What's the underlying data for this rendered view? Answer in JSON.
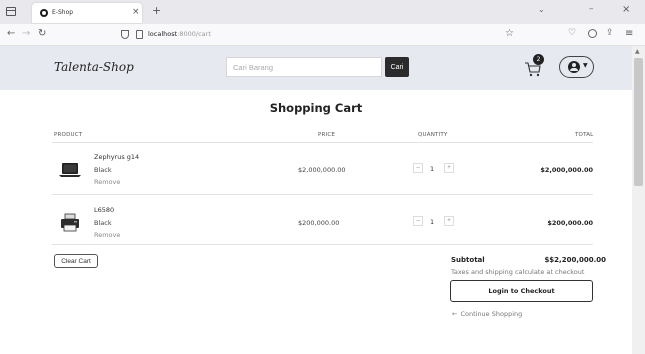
{
  "browser": {
    "tab_title": "E-Shop",
    "url_host": "localhost",
    "url_path": ":8000/cart",
    "icons": [
      "window-list-icon",
      "favicon",
      "close-icon",
      "plus-icon",
      "back-arrow-icon",
      "forward-arrow-icon",
      "reload-icon",
      "shield-icon",
      "page-icon",
      "star-icon",
      "pocket-icon",
      "account-icon",
      "share-icon",
      "menu-icon"
    ]
  },
  "header": {
    "logo": "Talenta-Shop",
    "search_placeholder": "Cari Barang",
    "search_button": "Cari",
    "cart_count": "2",
    "background_color": "#e6e9f0"
  },
  "cart": {
    "title": "Shopping Cart",
    "columns": {
      "product": "PRODUCT",
      "price": "PRICE",
      "quantity": "QUANTITY",
      "total": "TOTAL"
    },
    "items": [
      {
        "name": "Zephyrus g14",
        "variant": "Black",
        "remove_label": "Remove",
        "price": "$2,000,000.00",
        "quantity": "1",
        "total": "$2,000,000.00",
        "thumbnail": "laptop-icon"
      },
      {
        "name": "L6580",
        "variant": "Black",
        "remove_label": "Remove",
        "price": "$200,000.00",
        "quantity": "1",
        "total": "$200,000.00",
        "thumbnail": "printer-icon"
      }
    ],
    "clear_label": "Clear Cart",
    "subtotal_label": "Subtotal",
    "subtotal_value": "$$2,200,000.00",
    "tax_note": "Taxes and shipping calculate at checkout",
    "checkout_label": "Login to Checkout",
    "continue_label": "Continue Shopping"
  }
}
